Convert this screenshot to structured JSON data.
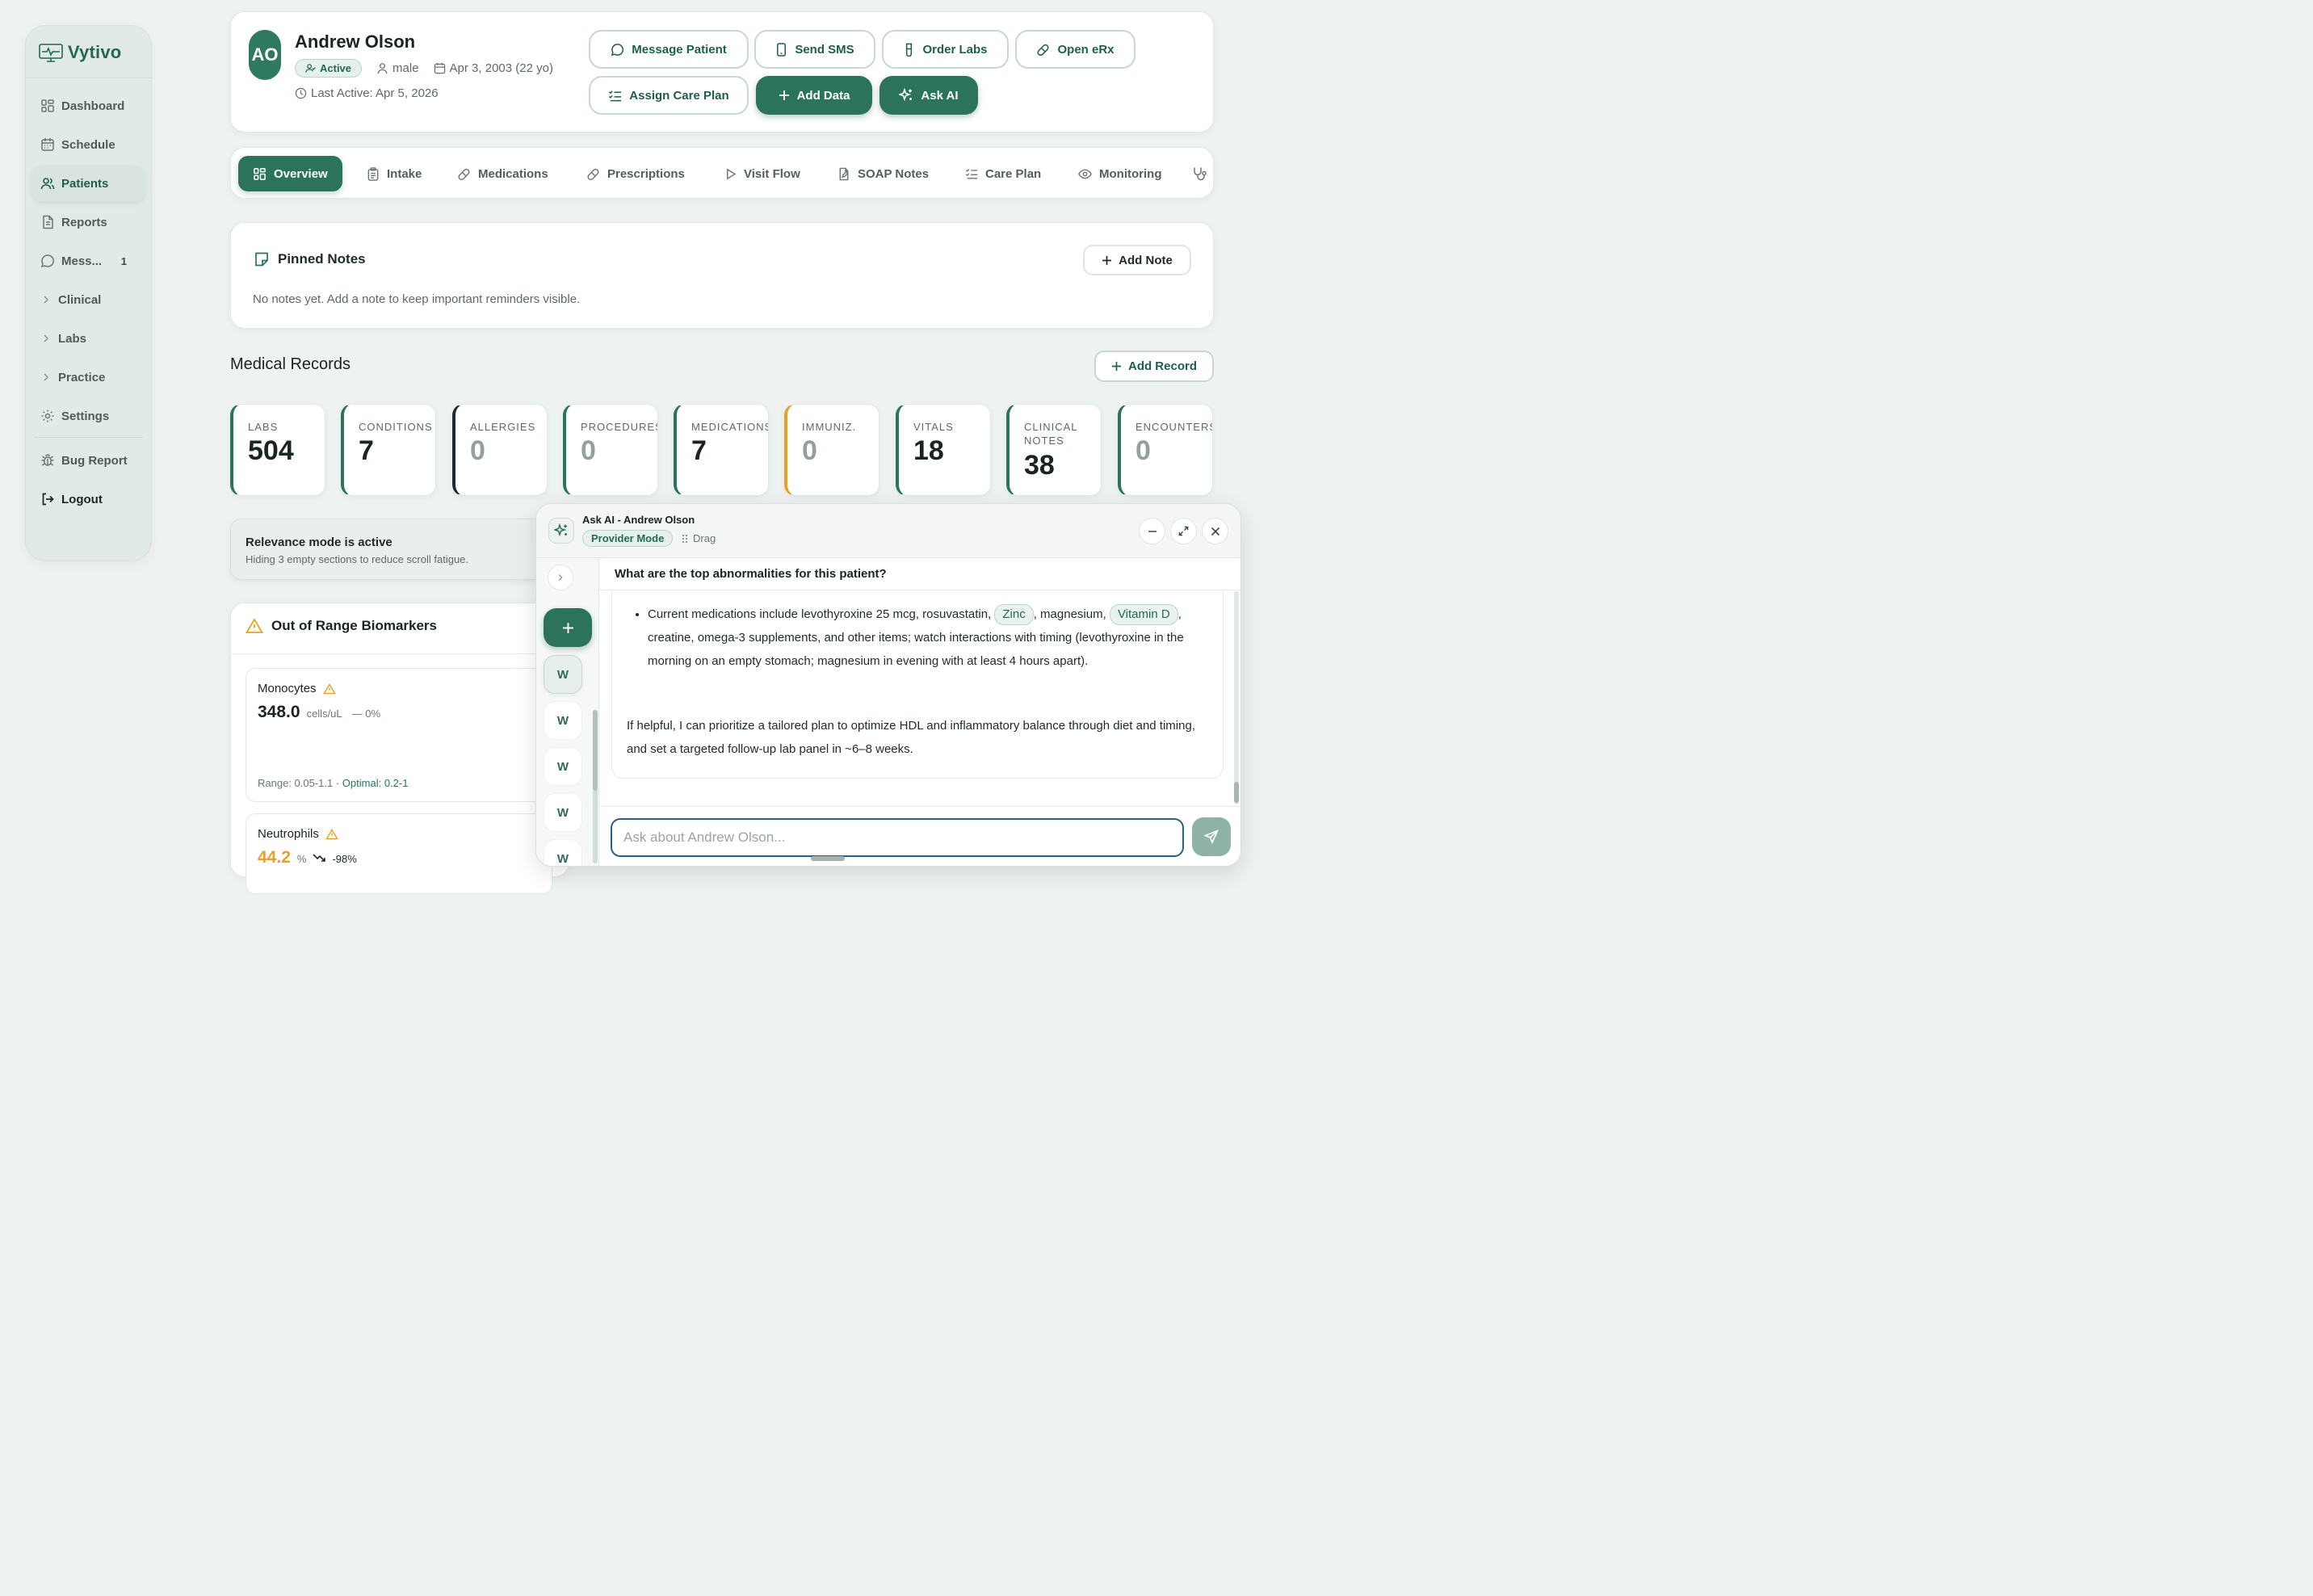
{
  "app": {
    "brand": "Vytivo"
  },
  "sidebar": {
    "items": [
      {
        "label": "Dashboard",
        "icon": "grid-icon"
      },
      {
        "label": "Schedule",
        "icon": "calendar-icon"
      },
      {
        "label": "Patients",
        "icon": "users-icon",
        "active": true
      },
      {
        "label": "Reports",
        "icon": "file-icon"
      },
      {
        "label": "Mess...",
        "icon": "message-icon",
        "badge": "1"
      },
      {
        "label": "Clinical",
        "icon": "chevron-right-icon"
      },
      {
        "label": "Labs",
        "icon": "chevron-right-icon"
      },
      {
        "label": "Practice",
        "icon": "chevron-right-icon"
      },
      {
        "label": "Settings",
        "icon": "gear-icon"
      }
    ],
    "bug_report": "Bug Report",
    "logout": "Logout"
  },
  "patient": {
    "initials": "AO",
    "name": "Andrew Olson",
    "status": "Active",
    "sex": "male",
    "dob": "Apr 3, 2003 (22 yo)",
    "last_active": "Last Active: Apr 5, 2026"
  },
  "actions": {
    "message_patient": "Message Patient",
    "send_sms": "Send SMS",
    "order_labs": "Order Labs",
    "open_erx": "Open eRx",
    "assign_care_plan": "Assign Care Plan",
    "add_data": "Add Data",
    "ask_ai": "Ask AI"
  },
  "tabs": [
    {
      "label": "Overview",
      "active": true
    },
    {
      "label": "Intake"
    },
    {
      "label": "Medications"
    },
    {
      "label": "Prescriptions"
    },
    {
      "label": "Visit Flow"
    },
    {
      "label": "SOAP Notes"
    },
    {
      "label": "Care Plan"
    },
    {
      "label": "Monitoring"
    }
  ],
  "pinned": {
    "title": "Pinned Notes",
    "empty": "No notes yet. Add a note to keep important reminders visible.",
    "add_label": "Add Note"
  },
  "records": {
    "title": "Medical Records",
    "add_label": "Add Record",
    "stats": [
      {
        "label": "LABS",
        "value": "504",
        "accent": "#2b7459"
      },
      {
        "label": "CONDITIONS",
        "value": "7",
        "accent": "#2b7459"
      },
      {
        "label": "ALLERGIES",
        "value": "0",
        "accent": "#1c2b33"
      },
      {
        "label": "PROCEDURES",
        "value": "0",
        "accent": "#2b7459"
      },
      {
        "label": "MEDICATIONS",
        "value": "7",
        "accent": "#2b7459"
      },
      {
        "label": "IMMUNIZ.",
        "value": "0",
        "accent": "#e7a127"
      },
      {
        "label": "VITALS",
        "value": "18",
        "accent": "#2b7459"
      },
      {
        "label": "CLINICAL NOTES",
        "value": "38",
        "accent": "#2b7459"
      },
      {
        "label": "ENCOUNTERS",
        "value": "0",
        "accent": "#2b7459"
      }
    ]
  },
  "relevance": {
    "title": "Relevance mode is active",
    "subtitle": "Hiding 3 empty sections to reduce scroll fatigue."
  },
  "biomarkers": {
    "title": "Out of Range Biomarkers",
    "items": [
      {
        "name": "Monocytes",
        "value": "348.0",
        "unit": "cells/uL",
        "change": "— 0%",
        "range": "Range: 0.05-1.1",
        "optimal": "· Optimal: 0.2-1",
        "value_color": "#1a2421"
      },
      {
        "name": "Neutrophils",
        "value": "44.2",
        "unit": "%",
        "change": "-98%",
        "value_color": "#e7a127"
      }
    ]
  },
  "ai": {
    "title": "Ask AI - Andrew Olson",
    "mode": "Provider Mode",
    "drag": "Drag",
    "question": "What are the top abnormalities for this patient?",
    "bullet_parts": {
      "a": "Current medications include levothyroxine 25 mcg, rosuvastatin, ",
      "chip1": "Zinc",
      "b": ", magnesium, ",
      "chip2": "Vitamin D",
      "c": ", creatine, omega-3 supplements, and other items; watch interactions with timing (levothyroxine in the morning on an empty stomach; magnesium in evening with at least 4 hours apart)."
    },
    "paragraph": "If helpful, I can prioritize a tailored plan to optimize HDL and inflammatory balance through diet and timing, and set a targeted follow-up lab panel in ~6–8 weeks.",
    "sessions": [
      "W",
      "W",
      "W",
      "W",
      "W"
    ],
    "input_placeholder": "Ask about Andrew Olson..."
  },
  "colors": {
    "primary": "#2b7459",
    "amber": "#e7a127",
    "focus": "#2a5f83"
  }
}
